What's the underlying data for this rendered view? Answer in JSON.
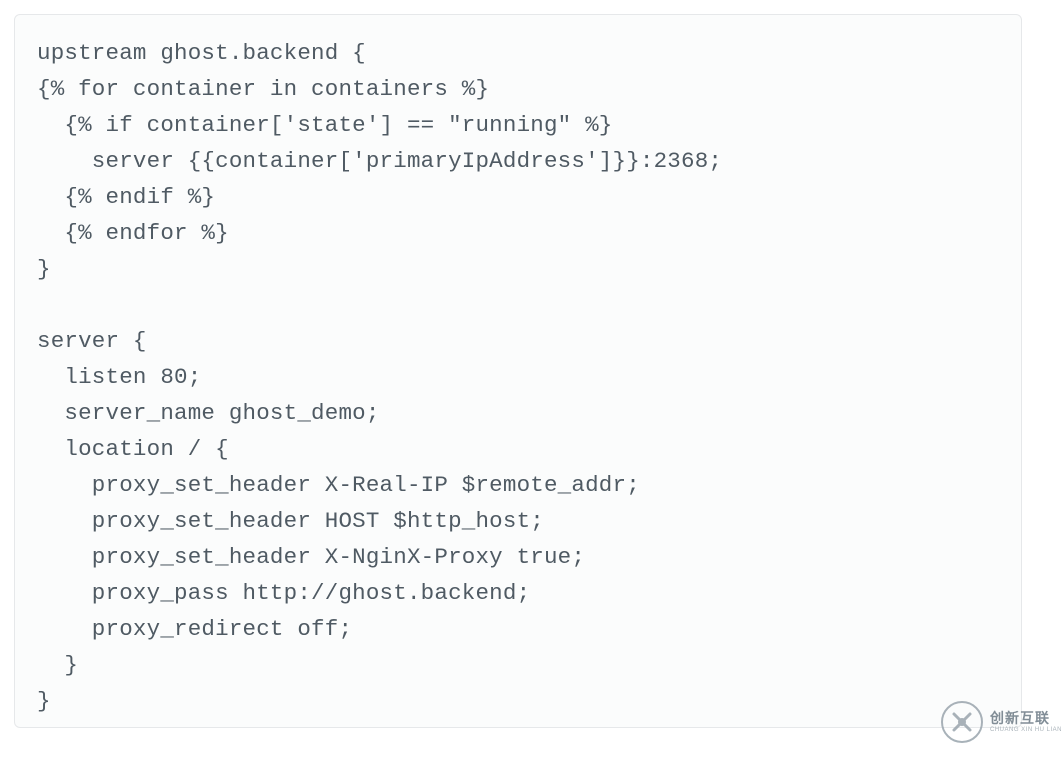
{
  "code": {
    "lines": [
      "upstream ghost.backend {",
      "{% for container in containers %}",
      "  {% if container['state'] == \"running\" %}",
      "    server {{container['primaryIpAddress']}}:2368;",
      "  {% endif %}",
      "  {% endfor %}",
      "}",
      "",
      "server {",
      "  listen 80;",
      "  server_name ghost_demo;",
      "  location / {",
      "    proxy_set_header X-Real-IP $remote_addr;",
      "    proxy_set_header HOST $http_host;",
      "    proxy_set_header X-NginX-Proxy true;",
      "    proxy_pass http://ghost.backend;",
      "    proxy_redirect off;",
      "  }",
      "}"
    ]
  },
  "watermark": {
    "zh": "创新互联",
    "en": "CHUANG XIN HU LIAN"
  }
}
